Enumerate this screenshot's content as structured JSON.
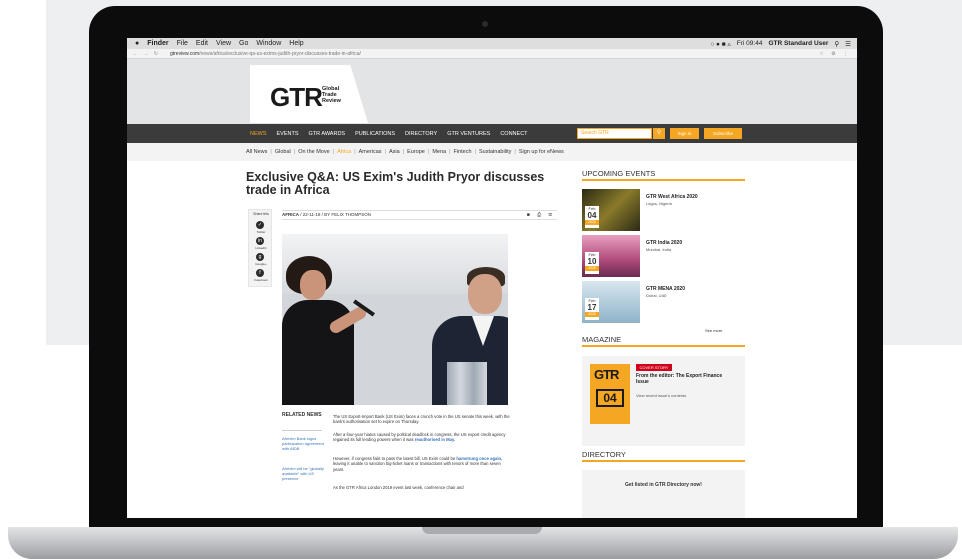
{
  "menubar": {
    "app_name": "Finder",
    "menus": [
      "File",
      "Edit",
      "View",
      "Go",
      "Window",
      "Help"
    ],
    "clock": "Fri 09:44",
    "user": "GTR Standard User"
  },
  "browser": {
    "url_host": "gtreview.com",
    "url_path": "/news/africa/exclusive-qa-us-exims-judith-pryor-discusses-trade-in-africa/"
  },
  "site": {
    "logo_text": "GTR",
    "logo_sub": "Global Trade Review",
    "nav": [
      "NEWS",
      "EVENTS",
      "GTR AWARDS",
      "PUBLICATIONS",
      "DIRECTORY",
      "GTR VENTURES",
      "CONNECT"
    ],
    "search_placeholder": "Search GTR",
    "signin_label": "Sign in",
    "subscribe_label": "Subscribe",
    "subnav": [
      "All News",
      "Global",
      "On the Move",
      "Africa",
      "Americas",
      "Asia",
      "Europe",
      "Mena",
      "Fintech",
      "Sustainability",
      "Sign up for eNews"
    ]
  },
  "article": {
    "title": "Exclusive Q&A: US Exim's Judith Pryor discusses trade in Africa",
    "byline_section": "AFRICA",
    "byline_rest": " / 22-11-19 / BY FELIX THOMPSON",
    "share_label": "Share this",
    "share": [
      "Twitter",
      "LinkedIn",
      "Google+",
      "Facebook"
    ],
    "related_head": "RELATED NEWS",
    "related_links": [
      "Afrexim Bank signs participation agreement with AfDB",
      "Afrexim will be \"globally available\" with US presence"
    ],
    "paragraphs": [
      "The US Export-Import Bank (US Exim) faces a crunch vote in the US senate this week, with the bank's authorisation set to expire on Thursday.",
      "After a four-year hiatus caused by political deadlock in congress, the US export credit agency regained its full lending powers when it was",
      "However, if congress fails to pass the latest bill, US Exim could be",
      "As the GTR Africa London 2019 event last week, conference chair and"
    ],
    "para2_link": "reauthorised in May.",
    "para3_link": "hamstrung once again,",
    "para3_tail": " leaving it unable to sanction big-ticket loans or transactions with tenors of more than seven years."
  },
  "sidebar": {
    "events_head": "UPCOMING EVENTS",
    "events": [
      {
        "month": "Feb",
        "day": "04",
        "year": "2020",
        "title": "GTR West Africa 2020",
        "location": "Lagos, Nigeria",
        "color": "#3a3a1c"
      },
      {
        "month": "Feb",
        "day": "10",
        "year": "2020",
        "title": "GTR India 2020",
        "location": "Mumbai, India",
        "color": "#c45a86"
      },
      {
        "month": "Feb",
        "day": "17",
        "year": "2020",
        "title": "GTR MENA 2020",
        "location": "Dubai, UAE",
        "color": "#8fb3c9"
      }
    ],
    "see_more": "See more",
    "magazine_head": "MAGAZINE",
    "mag_badge": "COVER STORY",
    "mag_title": "From the editor: The Export Finance Issue",
    "mag_link": "View recent issue's contents",
    "mag_cover_text": "GTR",
    "mag_cover_num": "04",
    "directory_head": "DIRECTORY",
    "directory_text": "Get listed in GTR Directory now!"
  },
  "colors": {
    "accent": "#f5a623",
    "nav_bg": "#3b3b3b",
    "link": "#3a73b9"
  }
}
